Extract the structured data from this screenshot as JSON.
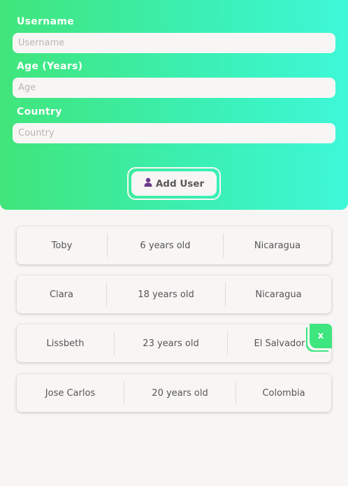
{
  "form": {
    "username": {
      "label": "Username",
      "placeholder": "Username",
      "value": ""
    },
    "age": {
      "label": "Age (Years)",
      "placeholder": "Age",
      "value": ""
    },
    "country": {
      "label": "Country",
      "placeholder": "Country",
      "value": ""
    },
    "add_button": {
      "label": "Add User",
      "icon": "user-icon"
    }
  },
  "colors": {
    "accent_green": "#40e57a",
    "accent_teal": "#3ef8d8",
    "background": "#f8f6f5",
    "icon_purple": "#6b3a8a"
  },
  "users": [
    {
      "name": "Toby",
      "age": "6 years old",
      "country": "Nicaragua"
    },
    {
      "name": "Clara",
      "age": "18 years old",
      "country": "Nicaragua"
    },
    {
      "name": "Lissbeth",
      "age": "23 years old",
      "country": "El Salvador",
      "delete_label": "x"
    },
    {
      "name": "Jose Carlos",
      "age": "20 years old",
      "country": "Colombia"
    }
  ]
}
